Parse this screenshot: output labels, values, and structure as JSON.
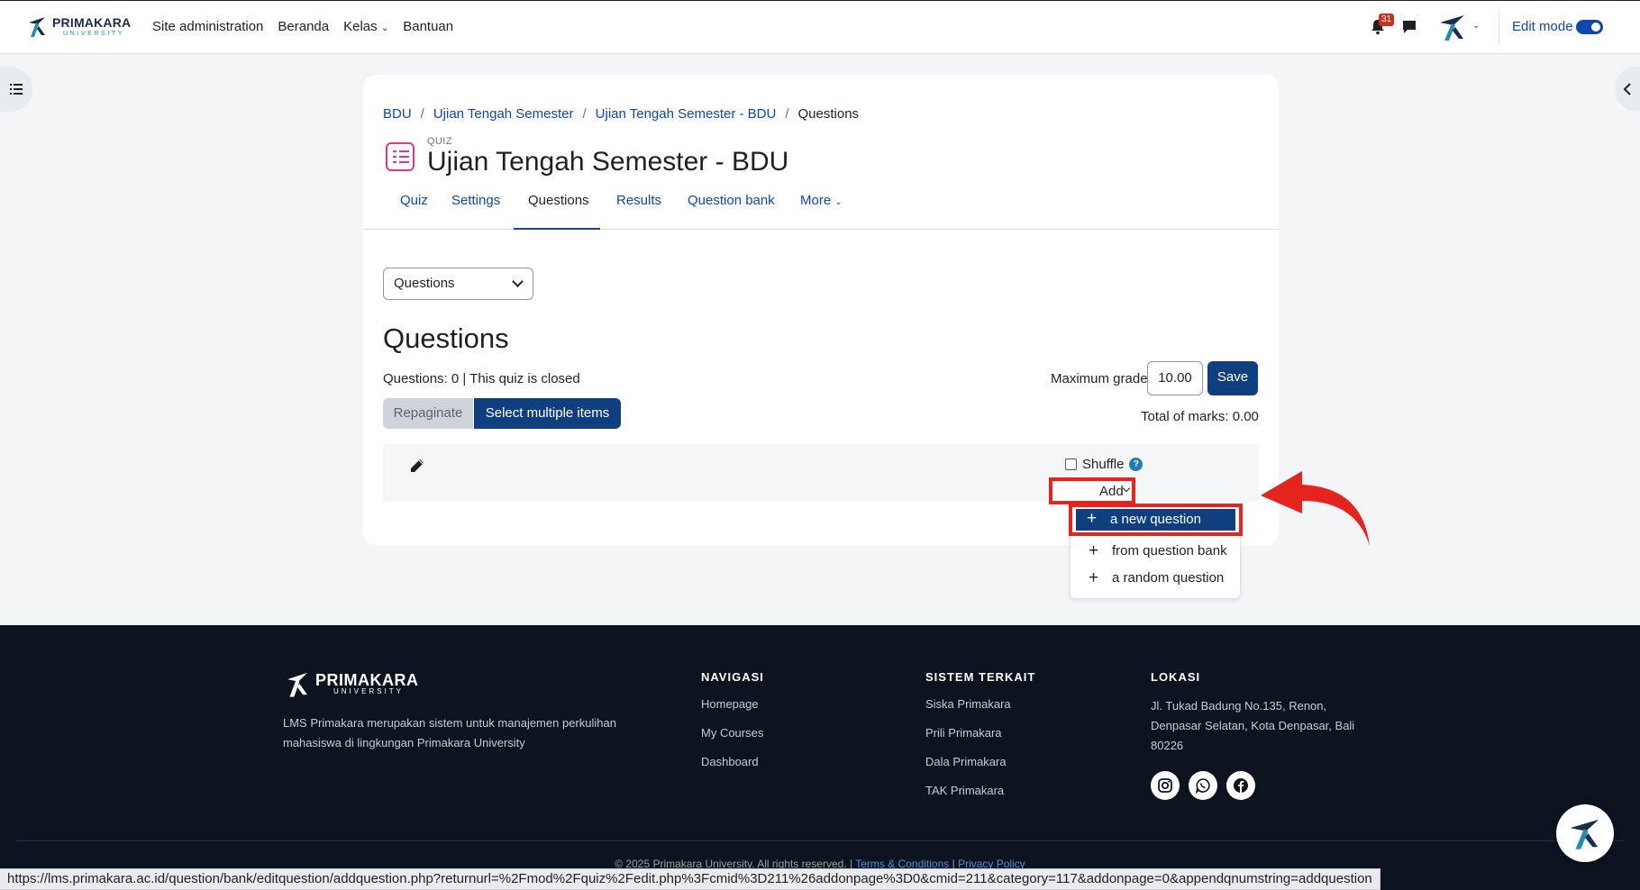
{
  "navbar": {
    "brand_name": "PRIMAKARA",
    "brand_sub": "UNIVERSITY",
    "items": [
      "Site administration",
      "Beranda",
      "Kelas",
      "Bantuan"
    ],
    "notification_count": "31",
    "edit_mode_label": "Edit mode",
    "edit_mode_on": true
  },
  "breadcrumb": [
    "BDU",
    "Ujian Tengah Semester",
    "Ujian Tengah Semester - BDU",
    "Questions"
  ],
  "header": {
    "label": "QUIZ",
    "title": "Ujian Tengah Semester - BDU"
  },
  "tabs": [
    "Quiz",
    "Settings",
    "Questions",
    "Results",
    "Question bank",
    "More"
  ],
  "active_tab": "Questions",
  "page_select": "Questions",
  "section_heading": "Questions",
  "status_text": "Questions: 0 | This quiz is closed",
  "max_grade": {
    "label": "Maximum grade",
    "value": "10.00",
    "save_label": "Save"
  },
  "buttons": {
    "repaginate": "Repaginate",
    "select_multiple": "Select multiple items"
  },
  "total_marks": "Total of marks: 0.00",
  "shuffle_label": "Shuffle",
  "add_label": "Add",
  "add_menu": [
    "a new question",
    "from question bank",
    "a random question"
  ],
  "footer": {
    "brand_name": "PRIMAKARA",
    "brand_sub": "UNIVERSITY",
    "description": "LMS Primakara merupakan sistem untuk manajemen perkulihan mahasiswa di lingkungan Primakara University",
    "nav_title": "NAVIGASI",
    "nav_links": [
      "Homepage",
      "My Courses",
      "Dashboard"
    ],
    "related_title": "SISTEM TERKAIT",
    "related_links": [
      "Siska Primakara",
      "Prili Primakara",
      "Dala Primakara",
      "TAK Primakara"
    ],
    "location_title": "LOKASI",
    "address": "Jl. Tukad Badung No.135, Renon, Denpasar Selatan, Kota Denpasar, Bali 80226",
    "copyright": "© 2025 Primakara University. All rights reserved. |",
    "terms": "Terms & Conditions",
    "privacy": "Privacy Policy"
  },
  "status_url": "https://lms.primakara.ac.id/question/bank/editquestion/addquestion.php?returnurl=%2Fmod%2Fquiz%2Fedit.php%3Fcmid%3D211%26addonpage%3D0&cmid=211&category=117&addonpage=0&appendqnumstring=addquestion",
  "colors": {
    "accent": "#0f3f7f",
    "link": "#0f47ad",
    "highlight_red": "#e52420",
    "footer_bg": "#0d1420"
  }
}
